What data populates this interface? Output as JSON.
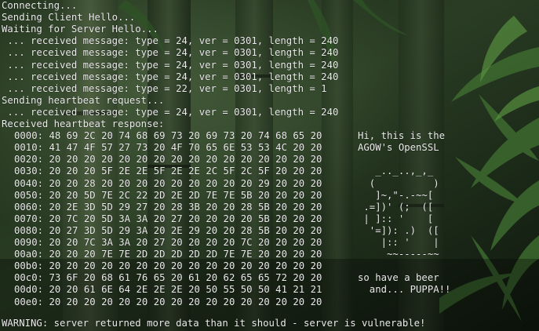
{
  "colors": {
    "terminal_text": "#ececec",
    "background_dark": "#0c130b",
    "bamboo_green": "#3d6a2f"
  },
  "terminal": {
    "status_lines": [
      "Connecting...",
      "Sending Client Hello...",
      "Waiting for Server Hello...",
      " ... received message: type = 24, ver = 0301, length = 240",
      " ... received message: type = 24, ver = 0301, length = 240",
      " ... received message: type = 24, ver = 0301, length = 240",
      " ... received message: type = 24, ver = 0301, length = 240",
      " ... received message: type = 22, ver = 0301, length = 1",
      "Sending heartbeat request...",
      " ... received message: type = 24, ver = 0301, length = 240",
      "Received heartbeat response:"
    ],
    "hex_dump": [
      {
        "offset": "0000:",
        "bytes": "48 69 2C 20 74 68 69 73 20 69 73 20 74 68 65 20",
        "ascii": "Hi, this is the"
      },
      {
        "offset": "0010:",
        "bytes": "41 47 4F 57 27 73 20 4F 70 65 6E 53 53 4C 20 20",
        "ascii": "AGOW's OpenSSL"
      },
      {
        "offset": "0020:",
        "bytes": "20 20 20 20 20 20 20 20 20 20 20 20 20 20 20 20",
        "ascii": ""
      },
      {
        "offset": "0030:",
        "bytes": "20 20 20 5F 2E 2E 5F 2E 2E 2C 5F 2C 5F 20 20 20",
        "ascii": "   _.._..,_,_"
      },
      {
        "offset": "0040:",
        "bytes": "20 20 28 20 20 20 20 20 20 20 20 20 29 20 20 20",
        "ascii": "  (          )"
      },
      {
        "offset": "0050:",
        "bytes": "20 20 5D 7E 2C 22 2D 2E 2D 7E 7E 5B 20 20 20 20",
        "ascii": "   ]~,\"-.-~~["
      },
      {
        "offset": "0060:",
        "bytes": "20 2E 3D 5D 29 27 20 28 3B 20 20 28 5B 20 20 20",
        "ascii": " .=])' (;  (["
      },
      {
        "offset": "0070:",
        "bytes": "20 7C 20 5D 3A 3A 20 27 20 20 20 20 5B 20 20 20",
        "ascii": " | ]:: '    ["
      },
      {
        "offset": "0080:",
        "bytes": "20 27 3D 5D 29 3A 20 2E 29 20 20 28 5B 20 20 20",
        "ascii": "  '=]): .)  (["
      },
      {
        "offset": "0090:",
        "bytes": "20 20 7C 3A 3A 20 27 20 20 20 20 7C 20 20 20 20",
        "ascii": "    |:: '    |"
      },
      {
        "offset": "00a0:",
        "bytes": "20 20 20 7E 7E 2D 2D 2D 2D 2D 7E 7E 20 20 20 20",
        "ascii": "     ~~-----~~"
      },
      {
        "offset": "00b0:",
        "bytes": "20 20 20 20 20 20 20 20 20 20 20 20 20 20 20 20",
        "ascii": ""
      },
      {
        "offset": "00c0:",
        "bytes": "73 6F 20 68 61 76 65 20 61 20 62 65 65 72 20 20",
        "ascii": "so have a beer"
      },
      {
        "offset": "00d0:",
        "bytes": "20 20 61 6E 64 2E 2E 2E 20 50 55 50 50 41 21 21",
        "ascii": "  and... PUPPA!!"
      },
      {
        "offset": "00e0:",
        "bytes": "20 20 20 20 20 20 20 20 20 20 20 20 20 20 20 20",
        "ascii": ""
      }
    ],
    "warning": "WARNING: server returned more data than it should - server is vulnerable!"
  }
}
